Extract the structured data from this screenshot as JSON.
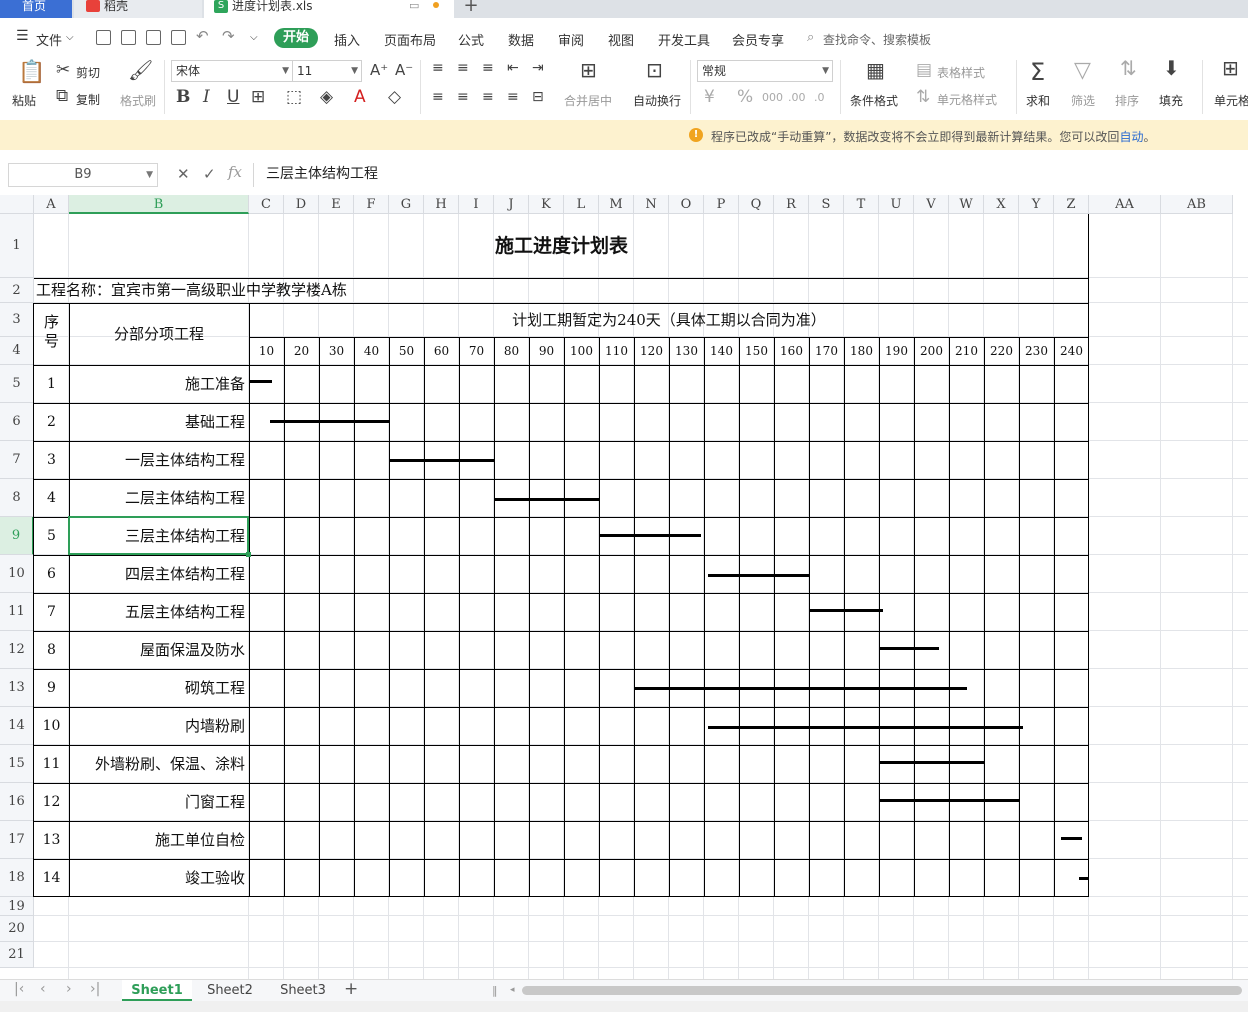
{
  "tabs": {
    "home": "首页",
    "app": "稻壳",
    "file": "进度计划表.xls",
    "add": "+"
  },
  "menu": {
    "file": "文件",
    "items": [
      "开始",
      "插入",
      "页面布局",
      "公式",
      "数据",
      "审阅",
      "视图",
      "开发工具",
      "会员专享"
    ],
    "search": "查找命令、搜索模板"
  },
  "ribbon": {
    "paste": "粘贴",
    "cut": "剪切",
    "copy": "复制",
    "format_painter": "格式刷",
    "font": "宋体",
    "size": "11",
    "number_format": "常规",
    "merge": "合并居中",
    "wrap": "自动换行",
    "cond_format": "条件格式",
    "table_style": "表格样式",
    "cell_style": "单元格样式",
    "sum": "求和",
    "filter": "筛选",
    "sort": "排序",
    "fill": "填充",
    "cell": "单元格",
    "bold": "B",
    "italic": "I",
    "underline": "U"
  },
  "notice": {
    "text": "程序已改成“手动重算”，数据改变将不会立即得到最新计算结果。您可以改回",
    "link": "自动",
    "end": "。"
  },
  "formula": {
    "cell_ref": "B9",
    "content": "三层主体结构工程"
  },
  "columns": [
    "A",
    "B",
    "C",
    "D",
    "E",
    "F",
    "G",
    "H",
    "I",
    "J",
    "K",
    "L",
    "M",
    "N",
    "O",
    "P",
    "Q",
    "R",
    "S",
    "T",
    "U",
    "V",
    "W",
    "X",
    "Y",
    "Z",
    "AA",
    "AB"
  ],
  "rows": [
    "1",
    "2",
    "3",
    "4",
    "5",
    "6",
    "7",
    "8",
    "9",
    "10",
    "11",
    "12",
    "13",
    "14",
    "15",
    "16",
    "17",
    "18",
    "19",
    "20",
    "21"
  ],
  "sheet": {
    "title": "施工进度计划表",
    "project": "工程名称：宜宾市第一高级职业中学教学楼A栋",
    "seq_header": "序号",
    "item_header": "分部分项工程",
    "period_header": "计划工期暂定为240天（具体工期以合同为准）",
    "days": [
      "10",
      "20",
      "30",
      "40",
      "50",
      "60",
      "70",
      "80",
      "90",
      "100",
      "110",
      "120",
      "130",
      "140",
      "150",
      "160",
      "170",
      "180",
      "190",
      "200",
      "210",
      "220",
      "230",
      "240"
    ],
    "tasks": [
      {
        "no": "1",
        "name": "施工准备",
        "start": 0,
        "end": 6.5
      },
      {
        "no": "2",
        "name": "基础工程",
        "start": 6,
        "end": 40
      },
      {
        "no": "3",
        "name": "一层主体结构工程",
        "start": 40,
        "end": 70
      },
      {
        "no": "4",
        "name": "二层主体结构工程",
        "start": 70,
        "end": 100
      },
      {
        "no": "5",
        "name": "三层主体结构工程",
        "start": 100,
        "end": 129
      },
      {
        "no": "6",
        "name": "四层主体结构工程",
        "start": 131,
        "end": 160
      },
      {
        "no": "7",
        "name": "五层主体结构工程",
        "start": 160,
        "end": 181
      },
      {
        "no": "8",
        "name": "屋面保温及防水",
        "start": 180,
        "end": 197
      },
      {
        "no": "9",
        "name": "砌筑工程",
        "start": 110,
        "end": 205
      },
      {
        "no": "10",
        "name": "内墙粉刷",
        "start": 131,
        "end": 221
      },
      {
        "no": "11",
        "name": "外墙粉刷、保温、涂料",
        "start": 180,
        "end": 210
      },
      {
        "no": "12",
        "name": "门窗工程",
        "start": 180,
        "end": 220
      },
      {
        "no": "13",
        "name": "施工单位自检",
        "start": 232,
        "end": 238
      },
      {
        "no": "14",
        "name": "竣工验收",
        "start": 237,
        "end": 240
      }
    ]
  },
  "sheets": [
    "Sheet1",
    "Sheet2",
    "Sheet3"
  ]
}
